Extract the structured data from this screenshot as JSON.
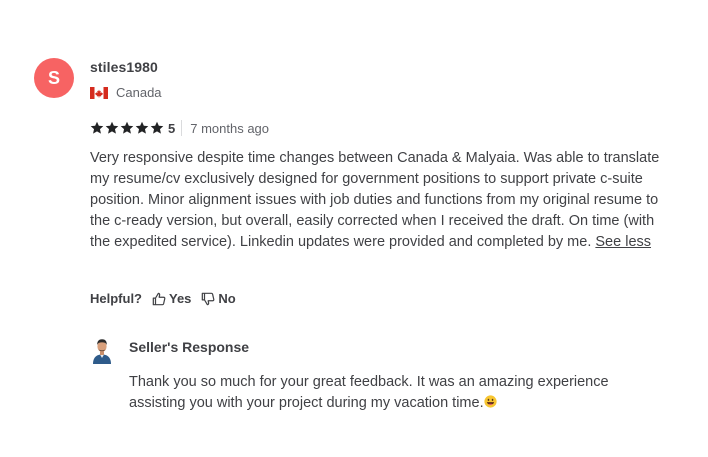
{
  "review": {
    "avatar_letter": "S",
    "avatar_color": "#f76363",
    "username": "stiles1980",
    "country": "Canada",
    "flag_icon": "canada-flag-icon",
    "rating": "5",
    "star_count": 5,
    "time_ago": "7 months ago",
    "text": "Very responsive despite time changes between Canada & Malyaia. Was able to translate my resume/cv exclusively designed for government positions to support private c-suite position. Minor alignment issues with job duties and functions from my original resume to the c-ready version, but overall, easily corrected when I received the draft. On time (with the expedited service). Linkedin updates were provided and completed by me.",
    "see_less_label": "See less"
  },
  "helpful": {
    "label": "Helpful?",
    "yes_label": "Yes",
    "no_label": "No"
  },
  "seller_response": {
    "title": "Seller's Response",
    "text": "Thank you so much for your great feedback. It was an amazing experience assisting you with your project during my vacation time.",
    "emoji": "grinning-face-emoji"
  }
}
